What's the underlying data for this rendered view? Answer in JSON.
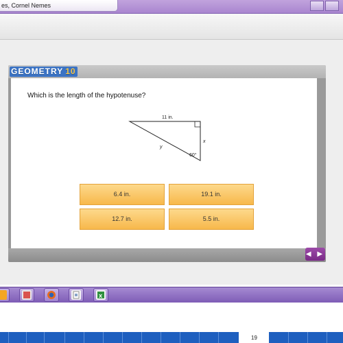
{
  "window": {
    "title": "es, Cornel Nemes"
  },
  "slide": {
    "logo_text": "GEOMETRY",
    "logo_version": "10",
    "question": "Which is the length of the hypotenuse?",
    "diagram": {
      "top_label": "11 in.",
      "right_label": "x",
      "hyp_label": "y",
      "angle_label": "60°"
    },
    "answers": [
      {
        "label": "6.4 in."
      },
      {
        "label": "19.1 in."
      },
      {
        "label": "12.7 in."
      },
      {
        "label": "5.5 in."
      }
    ],
    "nav_label": "◀ ▶"
  },
  "taskbar": {
    "icons": [
      "powerpoint-icon",
      "pdf-icon",
      "firefox-icon",
      "document-icon",
      "excel-icon"
    ]
  },
  "page": {
    "number": "19"
  },
  "colors": {
    "accent_purple": "#7e5cb6",
    "answer_orange": "#f7b84b",
    "logo_blue": "#3b73c4",
    "bottom_blue": "#1e5fbf"
  }
}
